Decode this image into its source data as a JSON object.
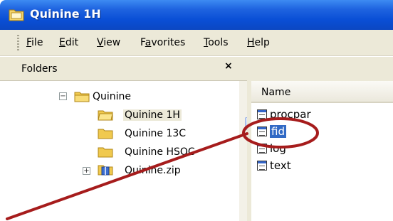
{
  "window": {
    "title": "Quinine 1H",
    "title_icon": "folder-window-icon"
  },
  "menubar": {
    "items": [
      {
        "pre": "",
        "u": "F",
        "post": "ile"
      },
      {
        "pre": "",
        "u": "E",
        "post": "dit"
      },
      {
        "pre": "",
        "u": "V",
        "post": "iew"
      },
      {
        "pre": "F",
        "u": "a",
        "post": "vorites"
      },
      {
        "pre": "",
        "u": "T",
        "post": "ools"
      },
      {
        "pre": "",
        "u": "H",
        "post": "elp"
      }
    ]
  },
  "folders_pane": {
    "header": "Folders",
    "close_glyph": "×",
    "tree": [
      {
        "label": "Quinine",
        "expander": "⊟"
      },
      {
        "label": "Quinine 1H"
      },
      {
        "label": "Quinine 13C"
      },
      {
        "label": "Quinine HSQC"
      },
      {
        "label": "Quinine.zip",
        "expander": "⊞"
      }
    ]
  },
  "files_pane": {
    "column_header": "Name",
    "files": [
      {
        "name": "procpar"
      },
      {
        "name": "fid",
        "selected": true
      },
      {
        "name": "log"
      },
      {
        "name": "text"
      }
    ]
  },
  "annotation": {
    "color": "#a61c1c"
  }
}
